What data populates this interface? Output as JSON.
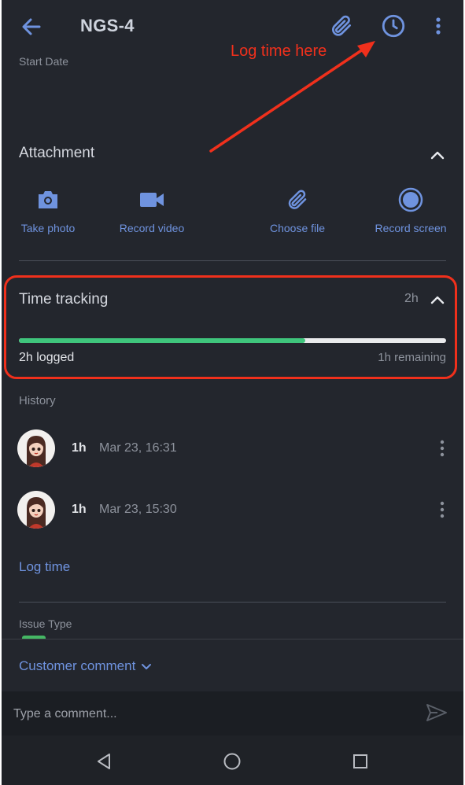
{
  "app_bar": {
    "title": "NGS-4",
    "icons": [
      "back-arrow-icon",
      "paperclip-icon",
      "clock-icon",
      "more-vert-icon"
    ]
  },
  "fields": {
    "start_date_label": "Start Date",
    "issue_type_label": "Issue Type"
  },
  "attachment": {
    "title": "Attachment",
    "options": [
      {
        "label": "Take photo",
        "icon": "camera-icon"
      },
      {
        "label": "Record video",
        "icon": "video-camera-icon"
      },
      {
        "label": "Choose file",
        "icon": "paperclip-icon"
      },
      {
        "label": "Record screen",
        "icon": "record-screen-icon"
      }
    ]
  },
  "time_tracking": {
    "title": "Time tracking",
    "estimate": "2h",
    "logged": "2h logged",
    "remaining": "1h remaining",
    "progress_fraction": 0.67
  },
  "history": {
    "label": "History",
    "entries": [
      {
        "duration": "1h",
        "time": "Mar 23, 16:31"
      },
      {
        "duration": "1h",
        "time": "Mar 23, 15:30"
      }
    ]
  },
  "log_time_link": "Log time",
  "customer_comment": {
    "label": "Customer comment"
  },
  "comment": {
    "placeholder": "Type a comment..."
  },
  "annotation": {
    "text": "Log time here"
  },
  "colors": {
    "background": "#23262d",
    "accent": "#6f93df",
    "progress": "#3fc57c",
    "highlight": "#f0301c"
  }
}
